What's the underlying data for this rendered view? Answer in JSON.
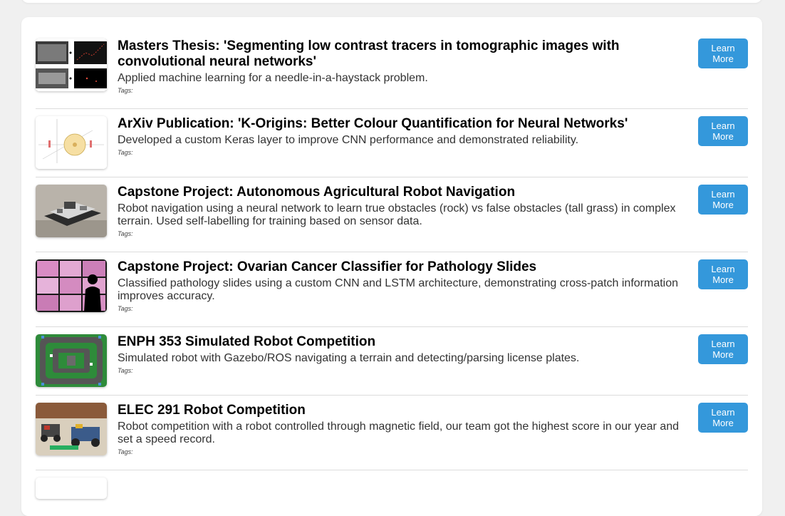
{
  "learn_more_label": [
    "Learn",
    "More"
  ],
  "projects": [
    {
      "title": "Masters Thesis: 'Segmenting low contrast tracers in tomographic images with convolutional neural networks'",
      "description": "Applied machine learning for a needle-in-a-haystack problem.",
      "tags_label": "Tags:"
    },
    {
      "title": "ArXiv Publication: 'K-Origins: Better Colour Quantification for Neural Networks'",
      "description": "Developed a custom Keras layer to improve CNN performance and demonstrated reliability.",
      "tags_label": "Tags:"
    },
    {
      "title": "Capstone Project: Autonomous Agricultural Robot Navigation",
      "description": "Robot navigation using a neural network to learn true obstacles (rock) vs false obstacles (tall grass) in complex terrain. Used self-labelling for training based on sensor data.",
      "tags_label": "Tags:"
    },
    {
      "title": "Capstone Project: Ovarian Cancer Classifier for Pathology Slides",
      "description": "Classified pathology slides using a custom CNN and LSTM architecture, demonstrating cross-patch information improves accuracy.",
      "tags_label": "Tags:"
    },
    {
      "title": "ENPH 353 Simulated Robot Competition",
      "description": "Simulated robot with Gazebo/ROS navigating a terrain and detecting/parsing license plates.",
      "tags_label": "Tags:"
    },
    {
      "title": "ELEC 291 Robot Competition",
      "description": "Robot competition with a robot controlled through magnetic field, our team got the highest score in our year and set a speed record.",
      "tags_label": "Tags:"
    }
  ],
  "colors": {
    "accent": "#3498db",
    "page_background": "#f0f0f0",
    "card_background": "#ffffff",
    "divider": "#dcdcdc"
  }
}
